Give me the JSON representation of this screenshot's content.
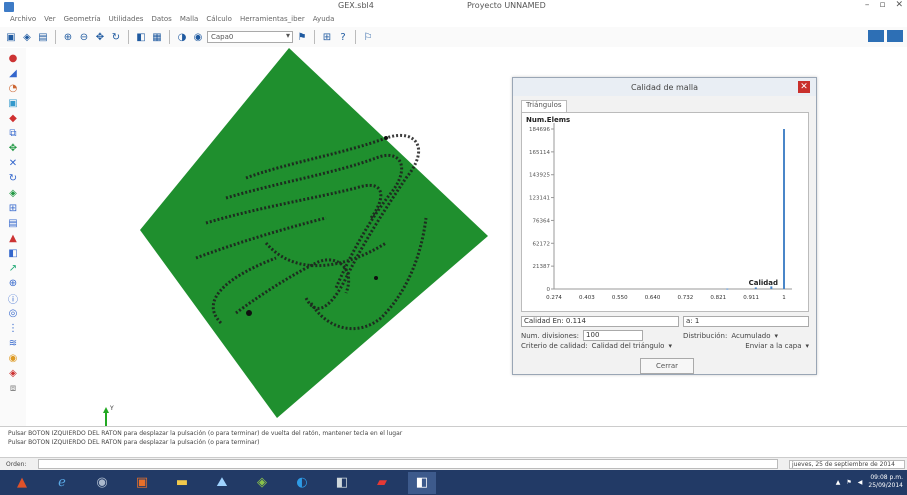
{
  "window": {
    "title_left": "GEX.sbl4",
    "title_right": "Proyecto UNNAMED",
    "min_label": "–",
    "max_label": "▫",
    "close_label": "✕"
  },
  "menu": [
    "Archivo",
    "Ver",
    "Geometría",
    "Utilidades",
    "Datos",
    "Malla",
    "Cálculo",
    "Herramientas_iber",
    "Ayuda"
  ],
  "toolbar": {
    "layer_select": "Capa0",
    "icons": [
      "open-icon",
      "save-icon",
      "print-icon",
      "zoom-in-icon",
      "zoom-out-icon",
      "pan-icon",
      "rotate-icon",
      "render-icon",
      "layers-icon",
      "help-icon"
    ]
  },
  "dialog": {
    "title": "Calidad de malla",
    "close_label": "✕",
    "tab_label": "Triángulos",
    "plot_ylabel": "Num.Elems",
    "plot_xlabel": "Calidad",
    "y_ticks": [
      "184696",
      "165114",
      "143925",
      "123141",
      "76364",
      "62172",
      "21387",
      "0"
    ],
    "x_ticks": [
      "0.274",
      "0.403",
      "0.550",
      "0.640",
      "0.732",
      "0.821",
      "0.911",
      "1"
    ],
    "quality_label": "Calidad En: 0.114",
    "quality_value": "a: 1",
    "num_divisions_label": "Num. divisiones:",
    "num_divisions_value": "100",
    "distribution_label": "Distribución:",
    "distribution_value": "Acumulado",
    "criterion_label": "Criterio de calidad:",
    "criterion_value": "Calidad del triángulo",
    "enviar_label": "Enviar a la capa",
    "close_button": "Cerrar"
  },
  "messages": [
    "Pulsar BOTON IZQUIERDO DEL RATON para desplazar la pulsación (o para terminar) de vuelta del ratón, mantener tecla en el lugar",
    "Pulsar BOTON IZQUIERDO DEL RATON para desplazar la pulsación (o para terminar)"
  ],
  "status": {
    "command_label": "Orden:",
    "date_text": "jueves, 25 de septiembre de 2014"
  },
  "taskbar": {
    "clock_time": "09:08 p.m.",
    "clock_date": "25/09/2014"
  },
  "chart_data": {
    "type": "bar",
    "title": "",
    "xlabel": "Calidad",
    "ylabel": "Num.Elems",
    "x": [
      0.274,
      0.403,
      0.55,
      0.64,
      0.732,
      0.821,
      0.911,
      0.96,
      1.0
    ],
    "values": [
      0,
      0,
      0,
      0,
      0,
      500,
      1800,
      3000,
      184696
    ],
    "ylim": [
      0,
      184696
    ],
    "xlim": [
      0.274,
      1
    ]
  },
  "colors": {
    "mesh_green": "#1f8f2e",
    "contour_dark": "#1d1d1d",
    "axis_y": "#22a822",
    "axis_x": "#2244cc",
    "bar_blue": "#4a86c8",
    "taskbar": "#223a66"
  }
}
